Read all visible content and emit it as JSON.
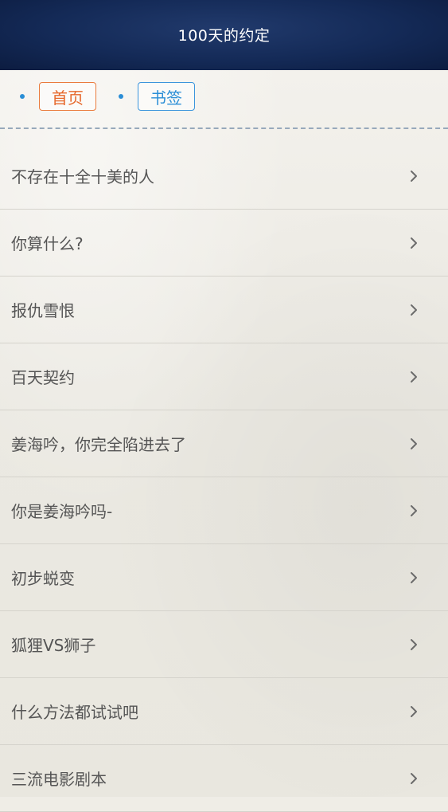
{
  "header": {
    "title": "100天的约定"
  },
  "tabs": [
    {
      "label": "首页",
      "color": "#e6672a"
    },
    {
      "label": "书签",
      "color": "#2a8ed6"
    }
  ],
  "chapters": [
    {
      "label": "不存在十全十美的人"
    },
    {
      "label": "你算什么?"
    },
    {
      "label": "报仇雪恨"
    },
    {
      "label": "百天契约"
    },
    {
      "label": "姜海吟，你完全陷进去了"
    },
    {
      "label": "你是姜海吟吗-"
    },
    {
      "label": "初步蜕变"
    },
    {
      "label": "狐狸VS狮子"
    },
    {
      "label": "什么方法都试试吧"
    },
    {
      "label": "三流电影剧本"
    }
  ],
  "icons": {
    "row_chevron": "chevron-right-icon"
  }
}
